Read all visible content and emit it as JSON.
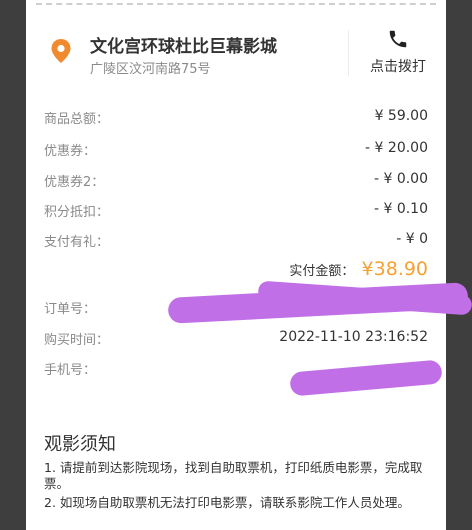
{
  "cinema": {
    "name": "文化宫环球杜比巨幕影城",
    "address": "广陵区汶河南路75号",
    "call_label": "点击拨打",
    "location_icon": "location-pin-icon",
    "phone_icon": "phone-icon"
  },
  "fees": [
    {
      "label": "商品总额：",
      "value": "¥ 59.00"
    },
    {
      "label": "优惠券：",
      "value": "- ¥ 20.00"
    },
    {
      "label": "优惠券2：",
      "value": "- ¥ 0.00"
    },
    {
      "label": "积分抵扣：",
      "value": "- ¥ 0.10"
    },
    {
      "label": "支付有礼：",
      "value": "- ¥ 0"
    }
  ],
  "total": {
    "label": "实付金额：",
    "value": "¥38.90"
  },
  "order": {
    "order_no_label": "订单号：",
    "time_label": "购买时间：",
    "time_value": "2022-11-10 23:16:52",
    "phone_label": "手机号："
  },
  "notice": {
    "title": "观影须知",
    "items": [
      "1. 请提前到达影院现场，找到自助取票机，打印纸质电影票，完成取票。",
      "2. 如现场自助取票机无法打印电影票，请联系影院工作人员处理。"
    ]
  },
  "colors": {
    "accent": "#f5a134",
    "pin": "#f08a2e",
    "redaction": "#c06fe6"
  }
}
